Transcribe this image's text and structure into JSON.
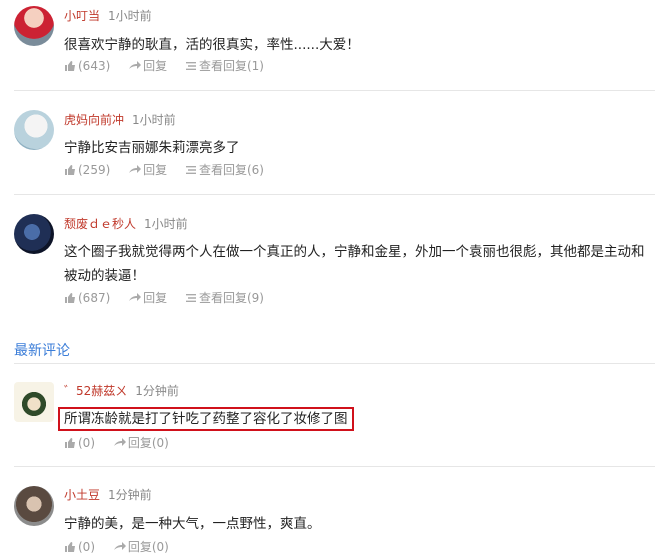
{
  "hot_comments": [
    {
      "user": "小叮当",
      "time": "1小时前",
      "text": "很喜欢宁静的耿直，活的很真实，率性......大爱！",
      "likes": "(643)",
      "reply": "回复",
      "view_replies": "查看回复(1)"
    },
    {
      "user": "虎妈向前冲",
      "time": "1小时前",
      "text": "宁静比安吉丽娜朱莉漂亮多了",
      "likes": "(259)",
      "reply": "回复",
      "view_replies": "查看回复(6)"
    },
    {
      "user": "颓废ｄｅ秒人",
      "time": "1小时前",
      "text": "这个圈子我就觉得两个人在做一个真正的人，宁静和金星，外加一个袁丽也很彪，其他都是主动和被动的装逼！",
      "likes": "(687)",
      "reply": "回复",
      "view_replies": "查看回复(9)"
    }
  ],
  "section_title": "最新评论",
  "latest_comments": [
    {
      "user": "゛52赫茲ㄨ",
      "time": "1分钟前",
      "text": "所谓冻龄就是打了针吃了药整了容化了妆修了图",
      "likes": "(0)",
      "reply": "回复(0)"
    },
    {
      "user": "小土豆",
      "time": "1分钟前",
      "text": "宁静的美，是一种大气，一点野性，爽直。",
      "likes": "(0)",
      "reply": "回复(0)"
    }
  ],
  "colors": {
    "username": "#c0392b",
    "section_title": "#3b7dd8",
    "highlight_border": "#d0111b"
  }
}
